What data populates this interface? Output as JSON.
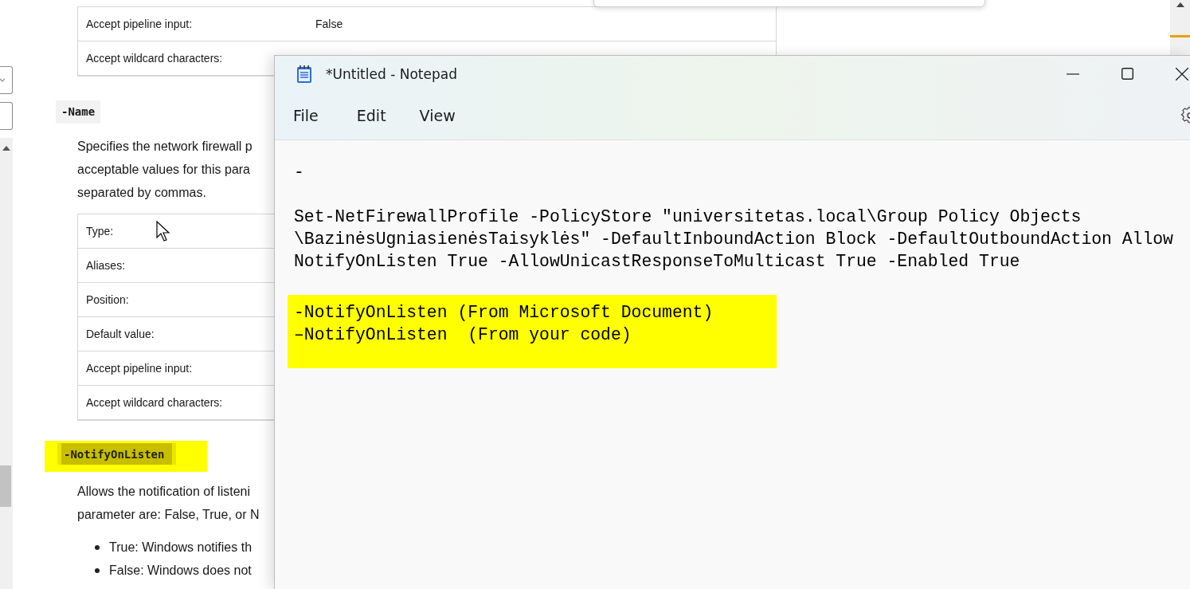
{
  "doc": {
    "top_table": {
      "rows": [
        {
          "label": "Accept pipeline input:",
          "value": "False"
        },
        {
          "label": "Accept wildcard characters:"
        }
      ]
    },
    "sections": [
      {
        "name": "-Name",
        "highlighted": false,
        "description": [
          "Specifies the network firewall p",
          "acceptable values for this para",
          "separated by commas."
        ],
        "table": {
          "rows": [
            {
              "label": "Type:"
            },
            {
              "label": "Aliases:"
            },
            {
              "label": "Position:"
            },
            {
              "label": "Default value:"
            },
            {
              "label": "Accept pipeline input:"
            },
            {
              "label": "Accept wildcard characters:"
            }
          ]
        }
      },
      {
        "name": "-NotifyOnListen",
        "highlighted": true,
        "description": [
          "Allows the notification of listeni",
          "parameter are: False, True, or N"
        ],
        "bullets": [
          "True: Windows notifies th",
          "False: Windows does not"
        ]
      }
    ]
  },
  "notepad": {
    "title": "*Untitled - Notepad",
    "menu": [
      "File",
      "Edit",
      "View"
    ],
    "blocks": [
      {
        "kind": "text",
        "lines": [
          "-"
        ]
      },
      {
        "kind": "text",
        "lines": [
          "Set-NetFirewallProfile -PolicyStore \"universitetas.local\\Group Policy Objects",
          "\\BazinėsUgniasienėsTaisyklės\" -DefaultInboundAction Block -DefaultOutboundAction Allow",
          "NotifyOnListen True -AllowUnicastResponseToMulticast True -Enabled True"
        ]
      },
      {
        "kind": "highlight",
        "lines": [
          "-NotifyOnListen (From Microsoft Document)",
          "–NotifyOnListen  (From your code)"
        ]
      }
    ]
  }
}
